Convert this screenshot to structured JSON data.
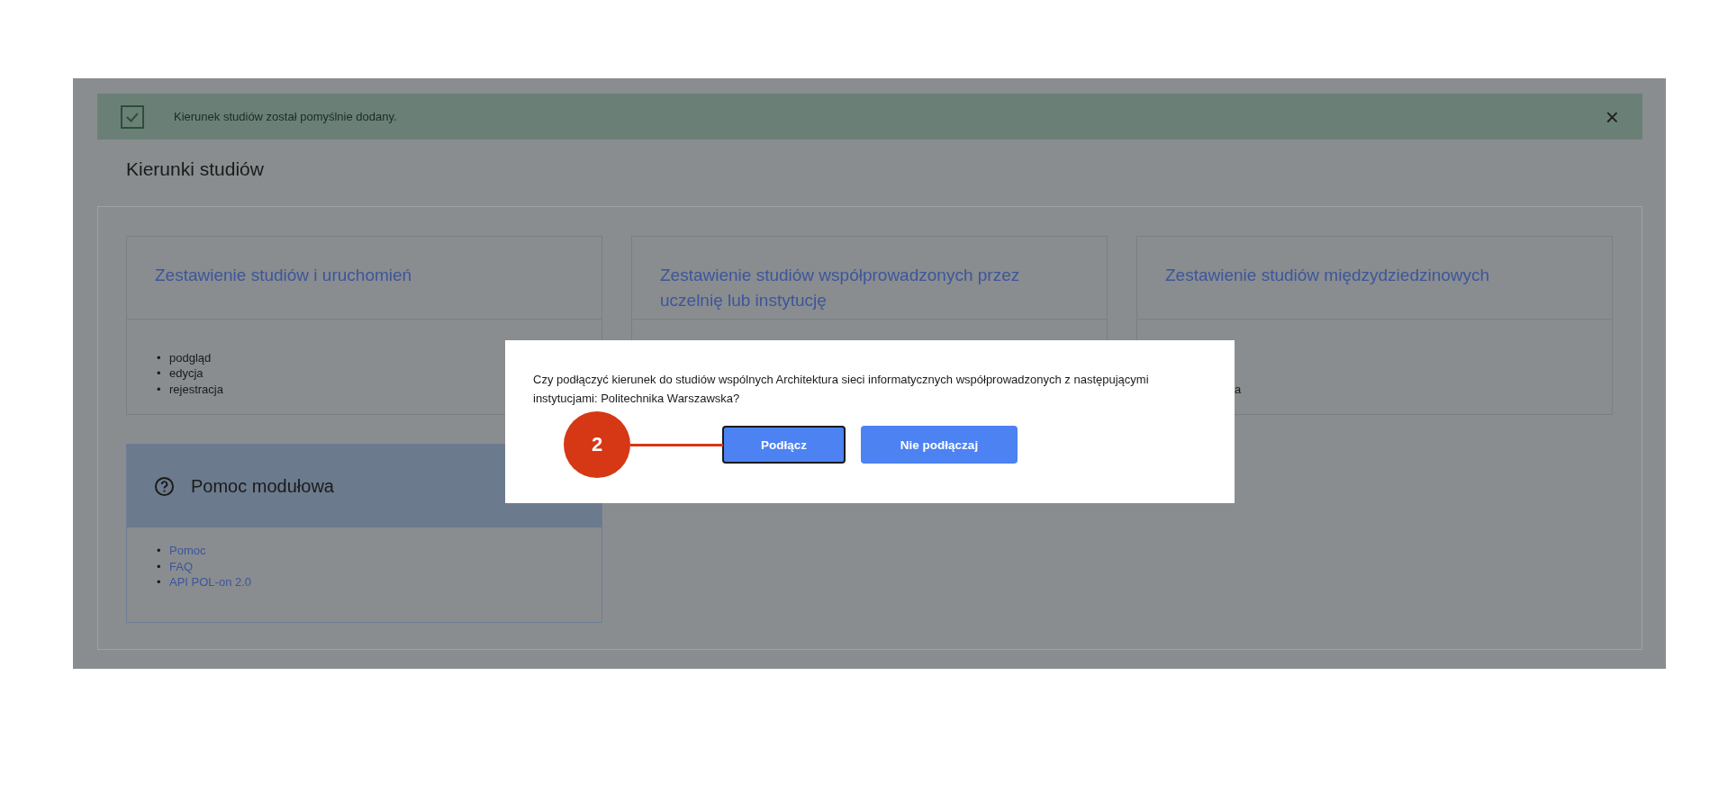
{
  "banner": {
    "message": "Kierunek studiów został pomyślnie dodany.",
    "close": "×"
  },
  "page_title": "Kierunki studiów",
  "cards": [
    {
      "title": "Zestawienie studiów i uruchomień",
      "items": [
        {
          "marker": "•",
          "text": "podgląd"
        },
        {
          "marker": "•",
          "text": "edycja"
        },
        {
          "marker": "•",
          "text": "rejestracja"
        }
      ]
    },
    {
      "title": "Zestawienie studiów współprowadzonych przez uczelnię lub instytucję"
    },
    {
      "title": "Zestawienie studiów międzydziedzinowych",
      "items": [
        {
          "text": "a"
        }
      ]
    }
  ],
  "help": {
    "title": "Pomoc modułowa",
    "links": [
      {
        "marker": "•",
        "text": "Pomoc"
      },
      {
        "marker": "•",
        "text": "FAQ"
      },
      {
        "marker": "•",
        "text": "API POL-on 2.0"
      }
    ]
  },
  "dialog": {
    "message": "Czy podłączyć kierunek do studiów wspólnych Architektura sieci informatycznych współprowadzonych z następującymi instytucjami: Politechnika Warszawska?",
    "buttons": [
      {
        "label": "Podłącz",
        "focused": true
      },
      {
        "label": "Nie podłączaj",
        "focused": false
      }
    ]
  },
  "callout": {
    "number": "2"
  }
}
